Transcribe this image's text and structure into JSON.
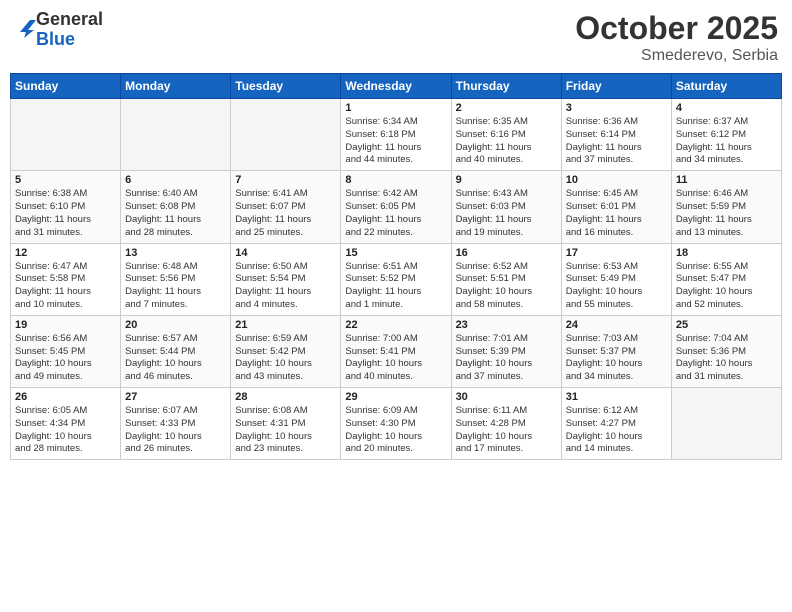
{
  "logo": {
    "general": "General",
    "blue": "Blue"
  },
  "header": {
    "month": "October 2025",
    "location": "Smederevo, Serbia"
  },
  "weekdays": [
    "Sunday",
    "Monday",
    "Tuesday",
    "Wednesday",
    "Thursday",
    "Friday",
    "Saturday"
  ],
  "weeks": [
    [
      {
        "day": "",
        "info": ""
      },
      {
        "day": "",
        "info": ""
      },
      {
        "day": "",
        "info": ""
      },
      {
        "day": "1",
        "info": "Sunrise: 6:34 AM\nSunset: 6:18 PM\nDaylight: 11 hours\nand 44 minutes."
      },
      {
        "day": "2",
        "info": "Sunrise: 6:35 AM\nSunset: 6:16 PM\nDaylight: 11 hours\nand 40 minutes."
      },
      {
        "day": "3",
        "info": "Sunrise: 6:36 AM\nSunset: 6:14 PM\nDaylight: 11 hours\nand 37 minutes."
      },
      {
        "day": "4",
        "info": "Sunrise: 6:37 AM\nSunset: 6:12 PM\nDaylight: 11 hours\nand 34 minutes."
      }
    ],
    [
      {
        "day": "5",
        "info": "Sunrise: 6:38 AM\nSunset: 6:10 PM\nDaylight: 11 hours\nand 31 minutes."
      },
      {
        "day": "6",
        "info": "Sunrise: 6:40 AM\nSunset: 6:08 PM\nDaylight: 11 hours\nand 28 minutes."
      },
      {
        "day": "7",
        "info": "Sunrise: 6:41 AM\nSunset: 6:07 PM\nDaylight: 11 hours\nand 25 minutes."
      },
      {
        "day": "8",
        "info": "Sunrise: 6:42 AM\nSunset: 6:05 PM\nDaylight: 11 hours\nand 22 minutes."
      },
      {
        "day": "9",
        "info": "Sunrise: 6:43 AM\nSunset: 6:03 PM\nDaylight: 11 hours\nand 19 minutes."
      },
      {
        "day": "10",
        "info": "Sunrise: 6:45 AM\nSunset: 6:01 PM\nDaylight: 11 hours\nand 16 minutes."
      },
      {
        "day": "11",
        "info": "Sunrise: 6:46 AM\nSunset: 5:59 PM\nDaylight: 11 hours\nand 13 minutes."
      }
    ],
    [
      {
        "day": "12",
        "info": "Sunrise: 6:47 AM\nSunset: 5:58 PM\nDaylight: 11 hours\nand 10 minutes."
      },
      {
        "day": "13",
        "info": "Sunrise: 6:48 AM\nSunset: 5:56 PM\nDaylight: 11 hours\nand 7 minutes."
      },
      {
        "day": "14",
        "info": "Sunrise: 6:50 AM\nSunset: 5:54 PM\nDaylight: 11 hours\nand 4 minutes."
      },
      {
        "day": "15",
        "info": "Sunrise: 6:51 AM\nSunset: 5:52 PM\nDaylight: 11 hours\nand 1 minute."
      },
      {
        "day": "16",
        "info": "Sunrise: 6:52 AM\nSunset: 5:51 PM\nDaylight: 10 hours\nand 58 minutes."
      },
      {
        "day": "17",
        "info": "Sunrise: 6:53 AM\nSunset: 5:49 PM\nDaylight: 10 hours\nand 55 minutes."
      },
      {
        "day": "18",
        "info": "Sunrise: 6:55 AM\nSunset: 5:47 PM\nDaylight: 10 hours\nand 52 minutes."
      }
    ],
    [
      {
        "day": "19",
        "info": "Sunrise: 6:56 AM\nSunset: 5:45 PM\nDaylight: 10 hours\nand 49 minutes."
      },
      {
        "day": "20",
        "info": "Sunrise: 6:57 AM\nSunset: 5:44 PM\nDaylight: 10 hours\nand 46 minutes."
      },
      {
        "day": "21",
        "info": "Sunrise: 6:59 AM\nSunset: 5:42 PM\nDaylight: 10 hours\nand 43 minutes."
      },
      {
        "day": "22",
        "info": "Sunrise: 7:00 AM\nSunset: 5:41 PM\nDaylight: 10 hours\nand 40 minutes."
      },
      {
        "day": "23",
        "info": "Sunrise: 7:01 AM\nSunset: 5:39 PM\nDaylight: 10 hours\nand 37 minutes."
      },
      {
        "day": "24",
        "info": "Sunrise: 7:03 AM\nSunset: 5:37 PM\nDaylight: 10 hours\nand 34 minutes."
      },
      {
        "day": "25",
        "info": "Sunrise: 7:04 AM\nSunset: 5:36 PM\nDaylight: 10 hours\nand 31 minutes."
      }
    ],
    [
      {
        "day": "26",
        "info": "Sunrise: 6:05 AM\nSunset: 4:34 PM\nDaylight: 10 hours\nand 28 minutes."
      },
      {
        "day": "27",
        "info": "Sunrise: 6:07 AM\nSunset: 4:33 PM\nDaylight: 10 hours\nand 26 minutes."
      },
      {
        "day": "28",
        "info": "Sunrise: 6:08 AM\nSunset: 4:31 PM\nDaylight: 10 hours\nand 23 minutes."
      },
      {
        "day": "29",
        "info": "Sunrise: 6:09 AM\nSunset: 4:30 PM\nDaylight: 10 hours\nand 20 minutes."
      },
      {
        "day": "30",
        "info": "Sunrise: 6:11 AM\nSunset: 4:28 PM\nDaylight: 10 hours\nand 17 minutes."
      },
      {
        "day": "31",
        "info": "Sunrise: 6:12 AM\nSunset: 4:27 PM\nDaylight: 10 hours\nand 14 minutes."
      },
      {
        "day": "",
        "info": ""
      }
    ]
  ]
}
